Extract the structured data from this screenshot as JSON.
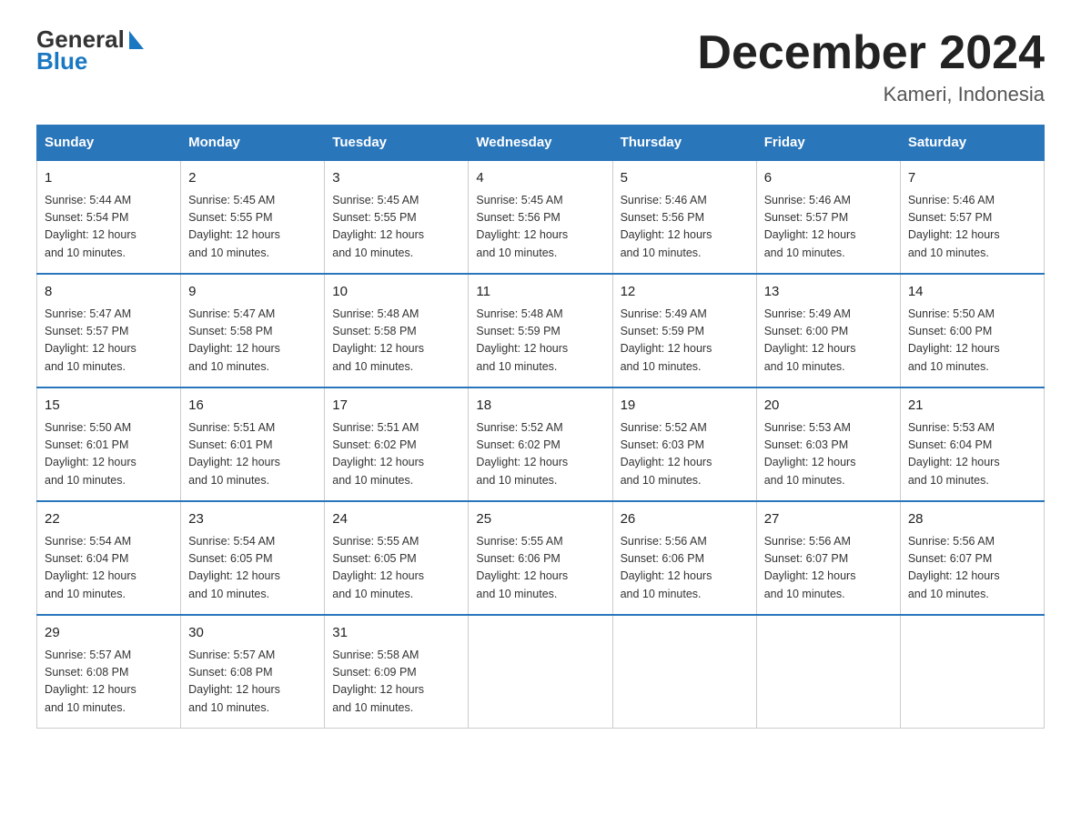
{
  "logo": {
    "text_general": "General",
    "text_blue": "Blue"
  },
  "title": "December 2024",
  "subtitle": "Kameri, Indonesia",
  "days_of_week": [
    "Sunday",
    "Monday",
    "Tuesday",
    "Wednesday",
    "Thursday",
    "Friday",
    "Saturday"
  ],
  "weeks": [
    [
      {
        "day": "1",
        "sunrise": "5:44 AM",
        "sunset": "5:54 PM",
        "daylight": "12 hours and 10 minutes."
      },
      {
        "day": "2",
        "sunrise": "5:45 AM",
        "sunset": "5:55 PM",
        "daylight": "12 hours and 10 minutes."
      },
      {
        "day": "3",
        "sunrise": "5:45 AM",
        "sunset": "5:55 PM",
        "daylight": "12 hours and 10 minutes."
      },
      {
        "day": "4",
        "sunrise": "5:45 AM",
        "sunset": "5:56 PM",
        "daylight": "12 hours and 10 minutes."
      },
      {
        "day": "5",
        "sunrise": "5:46 AM",
        "sunset": "5:56 PM",
        "daylight": "12 hours and 10 minutes."
      },
      {
        "day": "6",
        "sunrise": "5:46 AM",
        "sunset": "5:57 PM",
        "daylight": "12 hours and 10 minutes."
      },
      {
        "day": "7",
        "sunrise": "5:46 AM",
        "sunset": "5:57 PM",
        "daylight": "12 hours and 10 minutes."
      }
    ],
    [
      {
        "day": "8",
        "sunrise": "5:47 AM",
        "sunset": "5:57 PM",
        "daylight": "12 hours and 10 minutes."
      },
      {
        "day": "9",
        "sunrise": "5:47 AM",
        "sunset": "5:58 PM",
        "daylight": "12 hours and 10 minutes."
      },
      {
        "day": "10",
        "sunrise": "5:48 AM",
        "sunset": "5:58 PM",
        "daylight": "12 hours and 10 minutes."
      },
      {
        "day": "11",
        "sunrise": "5:48 AM",
        "sunset": "5:59 PM",
        "daylight": "12 hours and 10 minutes."
      },
      {
        "day": "12",
        "sunrise": "5:49 AM",
        "sunset": "5:59 PM",
        "daylight": "12 hours and 10 minutes."
      },
      {
        "day": "13",
        "sunrise": "5:49 AM",
        "sunset": "6:00 PM",
        "daylight": "12 hours and 10 minutes."
      },
      {
        "day": "14",
        "sunrise": "5:50 AM",
        "sunset": "6:00 PM",
        "daylight": "12 hours and 10 minutes."
      }
    ],
    [
      {
        "day": "15",
        "sunrise": "5:50 AM",
        "sunset": "6:01 PM",
        "daylight": "12 hours and 10 minutes."
      },
      {
        "day": "16",
        "sunrise": "5:51 AM",
        "sunset": "6:01 PM",
        "daylight": "12 hours and 10 minutes."
      },
      {
        "day": "17",
        "sunrise": "5:51 AM",
        "sunset": "6:02 PM",
        "daylight": "12 hours and 10 minutes."
      },
      {
        "day": "18",
        "sunrise": "5:52 AM",
        "sunset": "6:02 PM",
        "daylight": "12 hours and 10 minutes."
      },
      {
        "day": "19",
        "sunrise": "5:52 AM",
        "sunset": "6:03 PM",
        "daylight": "12 hours and 10 minutes."
      },
      {
        "day": "20",
        "sunrise": "5:53 AM",
        "sunset": "6:03 PM",
        "daylight": "12 hours and 10 minutes."
      },
      {
        "day": "21",
        "sunrise": "5:53 AM",
        "sunset": "6:04 PM",
        "daylight": "12 hours and 10 minutes."
      }
    ],
    [
      {
        "day": "22",
        "sunrise": "5:54 AM",
        "sunset": "6:04 PM",
        "daylight": "12 hours and 10 minutes."
      },
      {
        "day": "23",
        "sunrise": "5:54 AM",
        "sunset": "6:05 PM",
        "daylight": "12 hours and 10 minutes."
      },
      {
        "day": "24",
        "sunrise": "5:55 AM",
        "sunset": "6:05 PM",
        "daylight": "12 hours and 10 minutes."
      },
      {
        "day": "25",
        "sunrise": "5:55 AM",
        "sunset": "6:06 PM",
        "daylight": "12 hours and 10 minutes."
      },
      {
        "day": "26",
        "sunrise": "5:56 AM",
        "sunset": "6:06 PM",
        "daylight": "12 hours and 10 minutes."
      },
      {
        "day": "27",
        "sunrise": "5:56 AM",
        "sunset": "6:07 PM",
        "daylight": "12 hours and 10 minutes."
      },
      {
        "day": "28",
        "sunrise": "5:56 AM",
        "sunset": "6:07 PM",
        "daylight": "12 hours and 10 minutes."
      }
    ],
    [
      {
        "day": "29",
        "sunrise": "5:57 AM",
        "sunset": "6:08 PM",
        "daylight": "12 hours and 10 minutes."
      },
      {
        "day": "30",
        "sunrise": "5:57 AM",
        "sunset": "6:08 PM",
        "daylight": "12 hours and 10 minutes."
      },
      {
        "day": "31",
        "sunrise": "5:58 AM",
        "sunset": "6:09 PM",
        "daylight": "12 hours and 10 minutes."
      },
      null,
      null,
      null,
      null
    ]
  ],
  "labels": {
    "sunrise": "Sunrise:",
    "sunset": "Sunset:",
    "daylight": "Daylight: 12 hours"
  },
  "colors": {
    "header_bg": "#2a76bb",
    "border": "#2a76bb"
  }
}
